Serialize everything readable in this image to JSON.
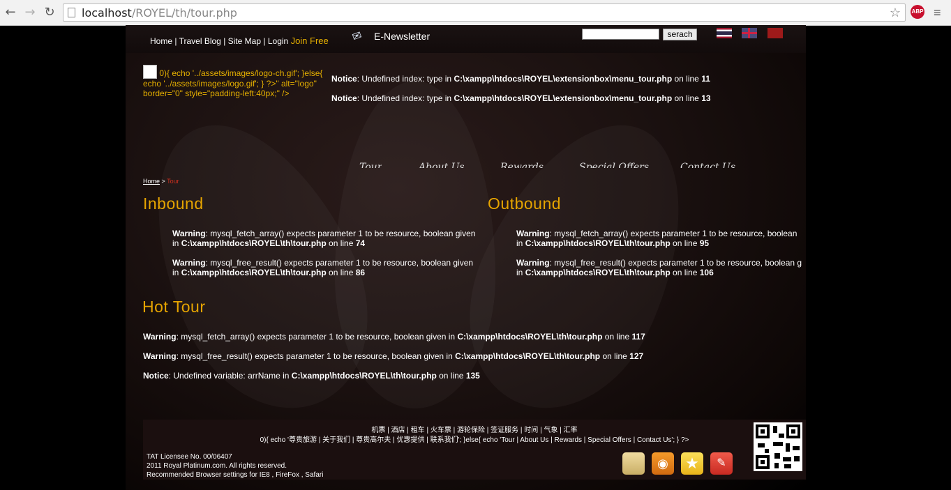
{
  "browser": {
    "url_host": "localhost",
    "url_path": "/ROYEL/th/tour.php",
    "abp_label": "ABP"
  },
  "topbar": {
    "links": [
      "Home",
      "Travel Blog",
      "Site Map",
      "Login"
    ],
    "separator": "|",
    "join_label": "Join Free",
    "newsletter_label": "E-Newsletter",
    "search_button": "serach"
  },
  "header": {
    "logo_alt_text": "0){ echo '../assets/images/logo-ch.gif'; }else{ echo '../assets/images/logo.gif'; } ?>\" alt=\"logo\" border=\"0\" style=\"padding-left:40px;\" />",
    "notices": [
      {
        "label": "Notice",
        "msg": ": Undefined index: type in ",
        "path": "C:\\xampp\\htdocs\\ROYEL\\extensionbox\\menu_tour.php",
        "on": " on line ",
        "line": "11"
      },
      {
        "label": "Notice",
        "msg": ": Undefined index: type in ",
        "path": "C:\\xampp\\htdocs\\ROYEL\\extensionbox\\menu_tour.php",
        "on": " on line ",
        "line": "13"
      }
    ],
    "main_nav": [
      "Tour",
      "About Us",
      "Rewards",
      "Special Offers",
      "Contact Us"
    ]
  },
  "breadcrumb": {
    "home": "Home",
    "sep": ">",
    "current": "Tour"
  },
  "inbound": {
    "title": "Inbound",
    "warnings": [
      {
        "label": "Warning",
        "msg": ": mysql_fetch_array() expects parameter 1 to be resource, boolean given",
        "in": "in ",
        "path": "C:\\xampp\\htdocs\\ROYEL\\th\\tour.php",
        "on": " on line ",
        "line": "74"
      },
      {
        "label": "Warning",
        "msg": ": mysql_free_result() expects parameter 1 to be resource, boolean given",
        "in": "in ",
        "path": "C:\\xampp\\htdocs\\ROYEL\\th\\tour.php",
        "on": " on line ",
        "line": "86"
      }
    ]
  },
  "outbound": {
    "title": "Outbound",
    "warnings": [
      {
        "label": "Warning",
        "msg": ": mysql_fetch_array() expects parameter 1 to be resource, boolean",
        "in": "in ",
        "path": "C:\\xampp\\htdocs\\ROYEL\\th\\tour.php",
        "on": " on line ",
        "line": "95"
      },
      {
        "label": "Warning",
        "msg": ": mysql_free_result() expects parameter 1 to be resource, boolean g",
        "in": "in ",
        "path": "C:\\xampp\\htdocs\\ROYEL\\th\\tour.php",
        "on": " on line ",
        "line": "106"
      }
    ]
  },
  "hot_tour": {
    "title": "Hot Tour",
    "messages": [
      {
        "label": "Warning",
        "msg": ": mysql_fetch_array() expects parameter 1 to be resource, boolean given in ",
        "path": "C:\\xampp\\htdocs\\ROYEL\\th\\tour.php",
        "on": " on line ",
        "line": "117"
      },
      {
        "label": "Warning",
        "msg": ": mysql_free_result() expects parameter 1 to be resource, boolean given in ",
        "path": "C:\\xampp\\htdocs\\ROYEL\\th\\tour.php",
        "on": " on line ",
        "line": "127"
      },
      {
        "label": "Notice",
        "msg": ": Undefined variable: arrName in ",
        "path": "C:\\xampp\\htdocs\\ROYEL\\th\\tour.php",
        "on": " on line ",
        "line": "135"
      }
    ]
  },
  "footer": {
    "links_line1": "机票 | 酒店 | 租车 | 火车票 | 游轮保险 | 签证服务 | 时间 | 气象 | 汇率",
    "links_line2": "0){ echo '尊贵旅游 | 关于我们 | 尊贵高尔夫 | 优惠提供 | 联系我们'; }else{ echo 'Tour | About Us | Rewards | Special Offers | Contact Us'; } ?>",
    "license": "TAT Licensee No. 00/06407",
    "copyright": "2011 Royal Platinum.com. All rights reserved.",
    "browser_note": "Recommended Browser settings for IE8 , FireFox , Safari"
  },
  "colors": {
    "accent": "#e6a400",
    "join": "#e6b000",
    "crumb_current": "#d03020"
  }
}
